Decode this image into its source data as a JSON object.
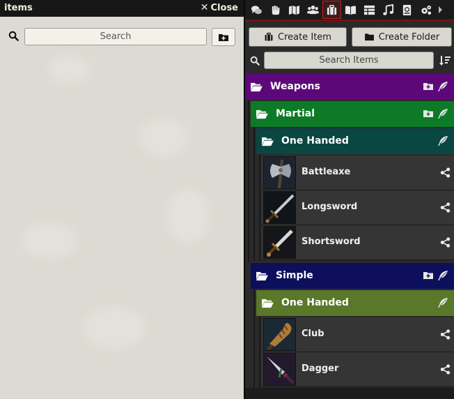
{
  "left_window": {
    "title": "items",
    "close_label": "Close",
    "search_placeholder": "Search"
  },
  "sidebar": {
    "tabs": [
      {
        "name": "chat",
        "icon": "chat-icon"
      },
      {
        "name": "combat",
        "icon": "fist-icon"
      },
      {
        "name": "scenes",
        "icon": "map-icon"
      },
      {
        "name": "actors",
        "icon": "users-icon"
      },
      {
        "name": "items",
        "icon": "suitcase-icon",
        "active": true
      },
      {
        "name": "journal",
        "icon": "book-icon"
      },
      {
        "name": "tables",
        "icon": "table-icon"
      },
      {
        "name": "playlists",
        "icon": "music-icon"
      },
      {
        "name": "compendium",
        "icon": "atlas-icon"
      },
      {
        "name": "settings",
        "icon": "cogs-icon"
      }
    ],
    "create_item_label": "Create Item",
    "create_folder_label": "Create Folder",
    "search_placeholder": "Search Items",
    "tree": {
      "weapons": {
        "name": "Weapons",
        "color": "#5d087a"
      },
      "martial": {
        "name": "Martial",
        "color": "#0c7a26"
      },
      "martial_one_handed": {
        "name": "One Handed",
        "color": "#0a4642"
      },
      "simple": {
        "name": "Simple",
        "color": "#0d0f5c"
      },
      "simple_one_handed": {
        "name": "One Handed",
        "color": "#59782a"
      }
    },
    "martial_items": [
      {
        "name": "Battleaxe",
        "icon": "battleaxe-icon"
      },
      {
        "name": "Longsword",
        "icon": "longsword-icon"
      },
      {
        "name": "Shortsword",
        "icon": "shortsword-icon"
      }
    ],
    "simple_items": [
      {
        "name": "Club",
        "icon": "club-icon"
      },
      {
        "name": "Dagger",
        "icon": "dagger-icon"
      }
    ]
  }
}
